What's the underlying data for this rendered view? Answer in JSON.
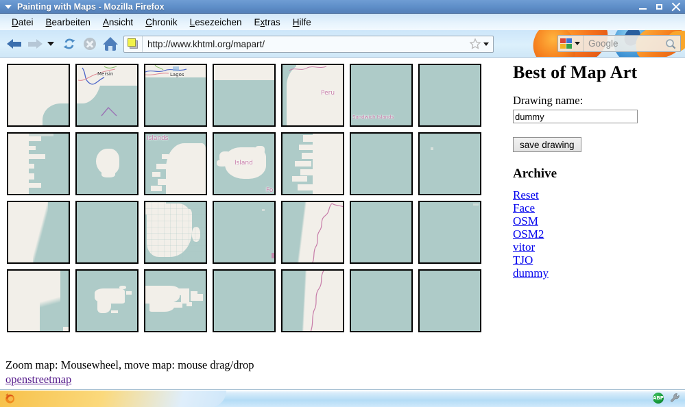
{
  "window": {
    "title": "Painting with Maps - Mozilla Firefox",
    "minimize_label": "Minimize",
    "maximize_label": "Maximize",
    "close_label": "Close"
  },
  "menubar": {
    "items": [
      {
        "accel": "D",
        "rest": "atei"
      },
      {
        "accel": "B",
        "rest": "earbeiten"
      },
      {
        "accel": "A",
        "rest": "nsicht"
      },
      {
        "accel": "C",
        "rest": "hronik"
      },
      {
        "accel": "L",
        "rest": "esezeichen"
      },
      {
        "pre": "E",
        "accel": "x",
        "rest": "tras"
      },
      {
        "accel": "H",
        "rest": "ilfe"
      }
    ]
  },
  "navbar": {
    "back_label": "Back",
    "forward_label": "Forward",
    "history_dropdown_label": "Recent pages",
    "reload_label": "Reload",
    "stop_label": "Stop",
    "home_label": "Home",
    "url": "http://www.khtml.org/mapart/",
    "bookmark_label": "Bookmark this page",
    "url_dropdown_label": "Show history",
    "search_placeholder": "Google",
    "search_engine": "Google",
    "search_go_label": "Search"
  },
  "page": {
    "hint": "Zoom map: Mousewheel, move map: mouse drag/drop",
    "osm_link": "openstreetmap"
  },
  "sidebar": {
    "heading": "Best of Map Art",
    "drawing_name_label": "Drawing name:",
    "drawing_name_value": "dummy",
    "drawing_name_placeholder": "",
    "save_button": "save drawing",
    "archive_heading": "Archive",
    "archive_links": [
      "Reset",
      "Face",
      "OSM",
      "OSM2",
      "vitor",
      "TJO",
      "dummy"
    ]
  },
  "tiles": {
    "rows": 4,
    "cols": 7,
    "labels": {
      "r0c1": "Mersin",
      "r0c2": "Lagos",
      "r0c4": "Peru",
      "r0c5": "Sandwich Islands",
      "r1c2": "Islands",
      "r1c3a": "Island",
      "r1c3b": "Fo"
    }
  },
  "statusbar": {
    "adblock_label": "ABP",
    "tools_label": "Tools"
  },
  "colors": {
    "water": "#aecbc8",
    "land": "#f2efe9",
    "link": "#0000ee",
    "visited_link": "#551a8b",
    "titlebar": "#5f8fc9"
  }
}
